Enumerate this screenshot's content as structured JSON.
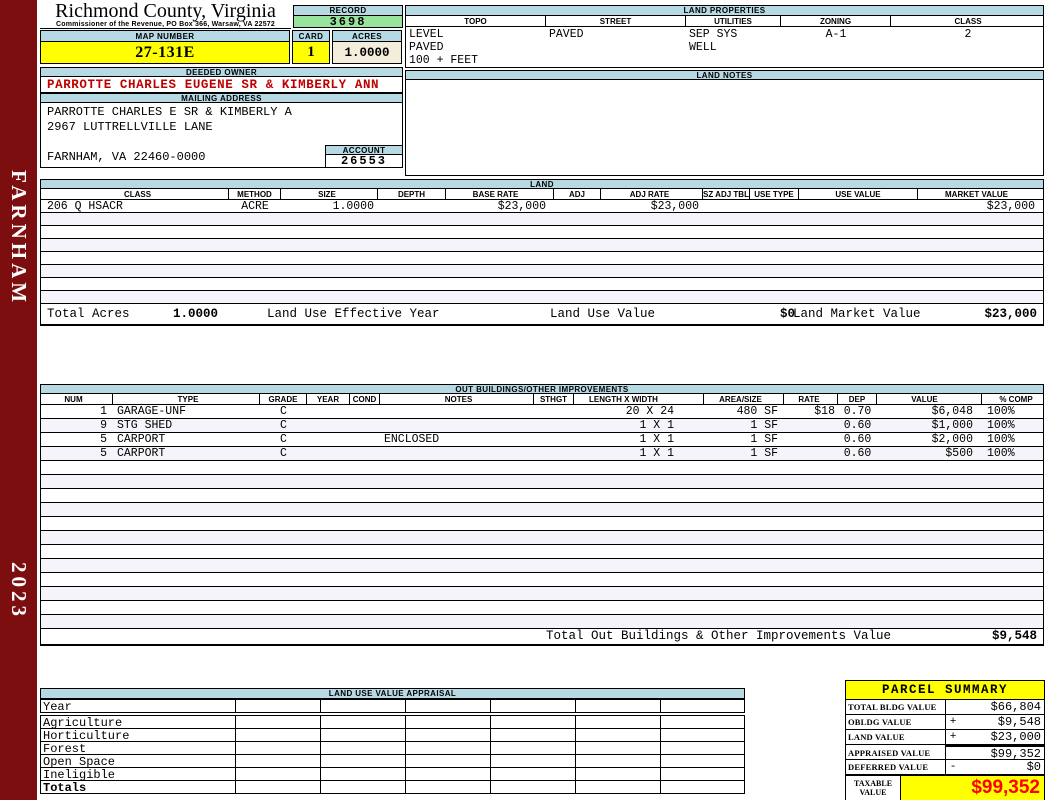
{
  "county": {
    "title": "Richmond County, Virginia",
    "subtitle": "Commissioner of the Revenue, PO Box 366, Warsaw, VA 22572"
  },
  "sidebar": {
    "district": "FARNHAM",
    "year": "2023"
  },
  "record": {
    "label": "RECORD",
    "value": "3698"
  },
  "map": {
    "label": "MAP NUMBER",
    "value": "27-131E"
  },
  "card": {
    "label": "CARD",
    "value": "1"
  },
  "acres": {
    "label": "ACRES",
    "value": "1.0000"
  },
  "land_properties": {
    "title": "LAND PROPERTIES",
    "columns": [
      "TOPO",
      "STREET",
      "UTILITIES",
      "ZONING",
      "CLASS"
    ],
    "topo": [
      "LEVEL",
      "PAVED",
      "100 + FEET"
    ],
    "street": [
      "PAVED"
    ],
    "utilities": [
      "SEP SYS",
      "WELL"
    ],
    "zoning": "A-1",
    "class": "2"
  },
  "owner": {
    "label": "DEEDED OWNER",
    "name": "PARROTTE CHARLES EUGENE SR & KIMBERLY ANN"
  },
  "mailing": {
    "label": "MAILING ADDRESS",
    "lines": [
      "PARROTTE CHARLES E SR & KIMBERLY A",
      "2967 LUTTRELLVILLE LANE",
      "",
      "FARNHAM, VA 22460-0000"
    ]
  },
  "account": {
    "label": "ACCOUNT",
    "value": "26553"
  },
  "land_notes": {
    "title": "LAND NOTES",
    "text": ""
  },
  "land": {
    "title": "LAND",
    "columns": [
      "CLASS",
      "METHOD",
      "SIZE",
      "DEPTH",
      "BASE RATE",
      "ADJ",
      "ADJ RATE",
      "SZ ADJ TBL",
      "USE TYPE",
      "USE VALUE",
      "MARKET VALUE"
    ],
    "rows": [
      [
        "206 Q HSACR",
        "ACRE",
        "1.0000",
        "",
        "$23,000",
        "",
        "$23,000",
        "",
        "",
        "",
        "$23,000"
      ]
    ],
    "empty_rows": 7,
    "totals": {
      "total_acres_label": "Total Acres",
      "total_acres": "1.0000",
      "effective_year_label": "Land Use Effective Year",
      "effective_year": "",
      "use_value_label": "Land Use Value",
      "use_value": "$0",
      "market_value_label": "Land Market Value",
      "market_value": "$23,000"
    }
  },
  "out_buildings": {
    "title": "OUT BUILDINGS/OTHER IMPROVEMENTS",
    "columns": [
      "NUM",
      "TYPE",
      "GRADE",
      "YEAR",
      "COND",
      "NOTES",
      "STHGT",
      "LENGTH X WIDTH",
      "AREA/SIZE",
      "RATE",
      "DEP",
      "VALUE",
      "% COMP"
    ],
    "rows": [
      [
        "1",
        "GARAGE-UNF",
        "C",
        "",
        "",
        "",
        "",
        "20 X 24",
        "480 SF",
        "$18",
        "0.70",
        "$6,048",
        "100%"
      ],
      [
        "9",
        "STG SHED",
        "C",
        "",
        "",
        "",
        "",
        "1 X 1",
        "1 SF",
        "",
        "0.60",
        "$1,000",
        "100%"
      ],
      [
        "5",
        "CARPORT",
        "C",
        "",
        "",
        "ENCLOSED",
        "",
        "1 X 1",
        "1 SF",
        "",
        "0.60",
        "$2,000",
        "100%"
      ],
      [
        "5",
        "CARPORT",
        "C",
        "",
        "",
        "",
        "",
        "1 X 1",
        "1 SF",
        "",
        "0.60",
        "$500",
        "100%"
      ]
    ],
    "empty_rows": 12,
    "total_label": "Total Out Buildings & Other Improvements Value",
    "total_value": "$9,548"
  },
  "land_use_appraisal": {
    "title": "LAND USE VALUE APPRAISAL",
    "row_labels": [
      "Year",
      "Agriculture",
      "Horticulture",
      "Forest",
      "Open Space",
      "Ineligible",
      "Totals"
    ],
    "data_columns": 6
  },
  "parcel_summary": {
    "title": "PARCEL SUMMARY",
    "rows": [
      {
        "label": "TOTAL BLDG VALUE",
        "op": "",
        "value": "$66,804"
      },
      {
        "label": "OBLDG VALUE",
        "op": "+",
        "value": "$9,548"
      },
      {
        "label": "LAND VALUE",
        "op": "+",
        "value": "$23,000"
      },
      {
        "label": "APPRAISED VALUE",
        "op": "",
        "value": "$99,352"
      },
      {
        "label": "DEFERRED VALUE",
        "op": "-",
        "value": "$0"
      }
    ],
    "taxable": {
      "label": "TAXABLE VALUE",
      "value": "$99,352"
    }
  },
  "colors": {
    "spine_maroon": "#7c0e10",
    "section_bar_blue": "#b7d9e4",
    "record_green": "#99e49c",
    "highlight_yellow": "#ffff00",
    "acres_cream": "#f2eedb",
    "owner_red": "#c00000",
    "taxable_red": "#ff0000"
  }
}
